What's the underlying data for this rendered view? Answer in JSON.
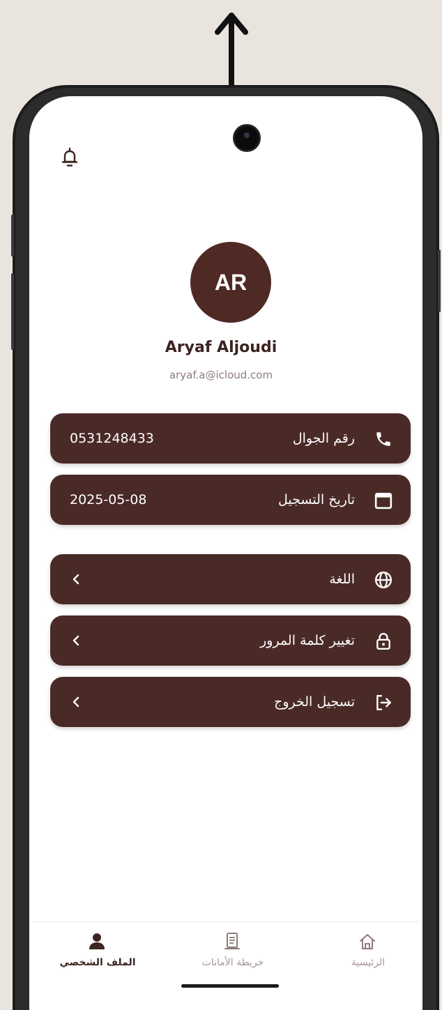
{
  "profile": {
    "initials": "AR",
    "name": "Aryaf Aljoudi",
    "email": "aryaf.a@icloud.com"
  },
  "info": {
    "phone": {
      "label": "رقم الجوال",
      "value": "0531248433",
      "icon": "phone-icon"
    },
    "registered": {
      "label": "تاريخ التسجيل",
      "value": "2025-05-08",
      "icon": "calendar-icon"
    }
  },
  "settings": [
    {
      "label": "اللغة",
      "icon": "globe-icon"
    },
    {
      "label": "تغيير كلمة المرور",
      "icon": "lock-icon"
    },
    {
      "label": "تسجيل الخروج",
      "icon": "logout-icon"
    }
  ],
  "tabs": {
    "profile": "الملف الشخصي",
    "map": "خريطة الأمانات",
    "home": "الرئيسية",
    "active": "profile"
  },
  "colors": {
    "primary": "#4a2a27",
    "background": "#e9e4de",
    "muted": "#8c7c7a"
  }
}
